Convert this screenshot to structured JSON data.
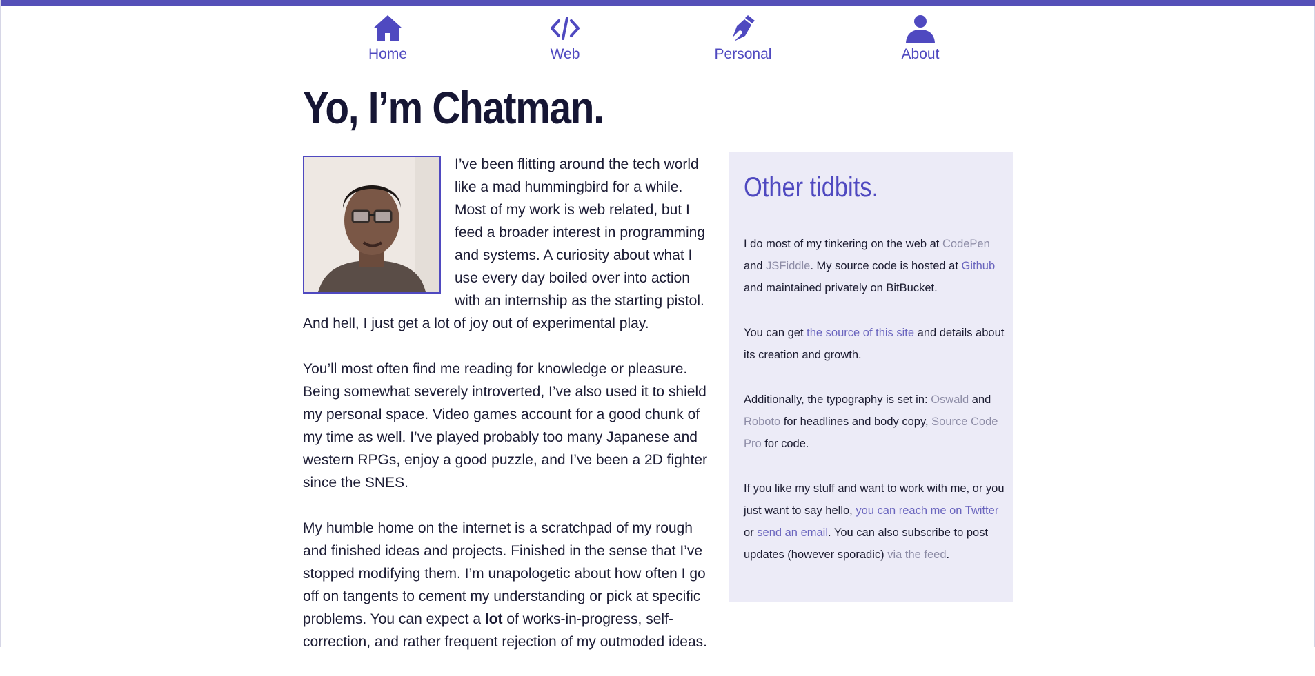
{
  "nav": [
    {
      "label": "Home",
      "icon": "home-icon"
    },
    {
      "label": "Web",
      "icon": "code-icon"
    },
    {
      "label": "Personal",
      "icon": "pen-icon"
    },
    {
      "label": "About",
      "icon": "person-icon"
    }
  ],
  "page": {
    "title": "Yo, I’m Chatman."
  },
  "main": {
    "p1": "I’ve been flitting around the tech world like a mad hummingbird for a while. Most of my work is web related, but I feed a broader interest in programming and systems. A curiosity about what I use every day boiled over into action with an internship as the starting pistol. And hell, I just get a lot of joy out of experimental play.",
    "p2": "You’ll most often find me reading for knowledge or pleasure. Being somewhat severely introverted, I’ve also used it to shield my personal space. Video games account for a good chunk of my time as well. I’ve played probably too many Japanese and western RPGs, enjoy a good puzzle, and I’ve been a 2D fighter since the SNES.",
    "p3_before": "My humble home on the internet is a scratchpad of my rough and finished ideas and projects. Finished in the sense that I’ve stopped modifying them. I’m unapologetic about how often I go off on tangents to cement my understanding or pick at specific problems. You can expect a ",
    "p3_bold": "lot",
    "p3_after": " of works-in-progress, self-correction, and rather frequent rejection of my outmoded ideas."
  },
  "aside": {
    "heading": "Other tidbits.",
    "t1a": "I do most of my tinkering on the web at ",
    "codepen": "CodePen",
    "t1b": " and ",
    "jsfiddle": "JSFiddle",
    "t1c": ". My source code is hosted at ",
    "github": "Github",
    "t1d": " and maintained privately on BitBucket.",
    "t2a": "You can get ",
    "source_link": "the source of this site",
    "t2b": " and details about its creation and growth.",
    "t3a": "Additionally, the typography is set in: ",
    "oswald": "Oswald",
    "t3b": " and ",
    "roboto": "Roboto",
    "t3c": " for headlines and body copy, ",
    "sourcecode": "Source Code Pro",
    "t3d": " for code.",
    "t4a": "If you like my stuff and want to work with me, or you just want to say hello, ",
    "twitter": "you can reach me on Twitter",
    "t4b": " or ",
    "email": "send an email",
    "t4c": ". You can also subscribe to post updates (however sporadic) ",
    "feed": "via the feed",
    "t4d": "."
  },
  "colors": {
    "accent": "#4f49c0",
    "aside_bg": "#ecebf7",
    "topbar": "#5550b8",
    "muted_link": "#8d8ca6"
  }
}
